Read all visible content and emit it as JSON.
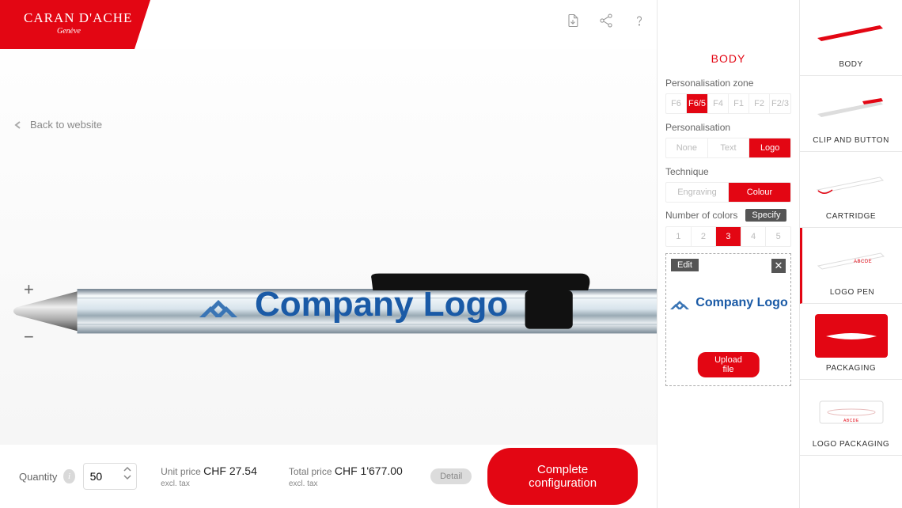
{
  "brand": {
    "name": "CARAN D'ACHE",
    "city": "Genève"
  },
  "header": {
    "back_label": "Back to website"
  },
  "preview": {
    "company_logo_text": "Company Logo"
  },
  "bottom": {
    "quantity_label": "Quantity",
    "quantity_value": "50",
    "unit_price_label": "Unit price",
    "unit_price_value": "CHF 27.54",
    "unit_price_tax": "excl. tax",
    "total_price_label": "Total price",
    "total_price_value": "CHF 1'677.00",
    "total_price_tax": "excl. tax",
    "detail_label": "Detail",
    "complete_label": "Complete configuration"
  },
  "panel": {
    "title": "BODY",
    "zone_label": "Personalisation zone",
    "zones": [
      "F6",
      "F6/5",
      "F4",
      "F1",
      "F2",
      "F2/3"
    ],
    "zone_active": "F6/5",
    "personalisation_label": "Personalisation",
    "personalisation_options": [
      "None",
      "Text",
      "Logo"
    ],
    "personalisation_active": "Logo",
    "technique_label": "Technique",
    "technique_options": [
      "Engraving",
      "Colour"
    ],
    "technique_active": "Colour",
    "colors_label": "Number of colors",
    "colors_specify": "Specify",
    "colors_options": [
      "1",
      "2",
      "3",
      "4",
      "5"
    ],
    "colors_active": "3",
    "logo_box": {
      "edit_label": "Edit",
      "preview_text": "Company Logo",
      "upload_label": "Upload file"
    }
  },
  "rail": {
    "items": [
      {
        "label": "BODY"
      },
      {
        "label": "CLIP AND BUTTON"
      },
      {
        "label": "CARTRIDGE"
      },
      {
        "label": "LOGO PEN",
        "active": true
      },
      {
        "label": "PACKAGING"
      },
      {
        "label": "LOGO PACKAGING"
      }
    ]
  }
}
